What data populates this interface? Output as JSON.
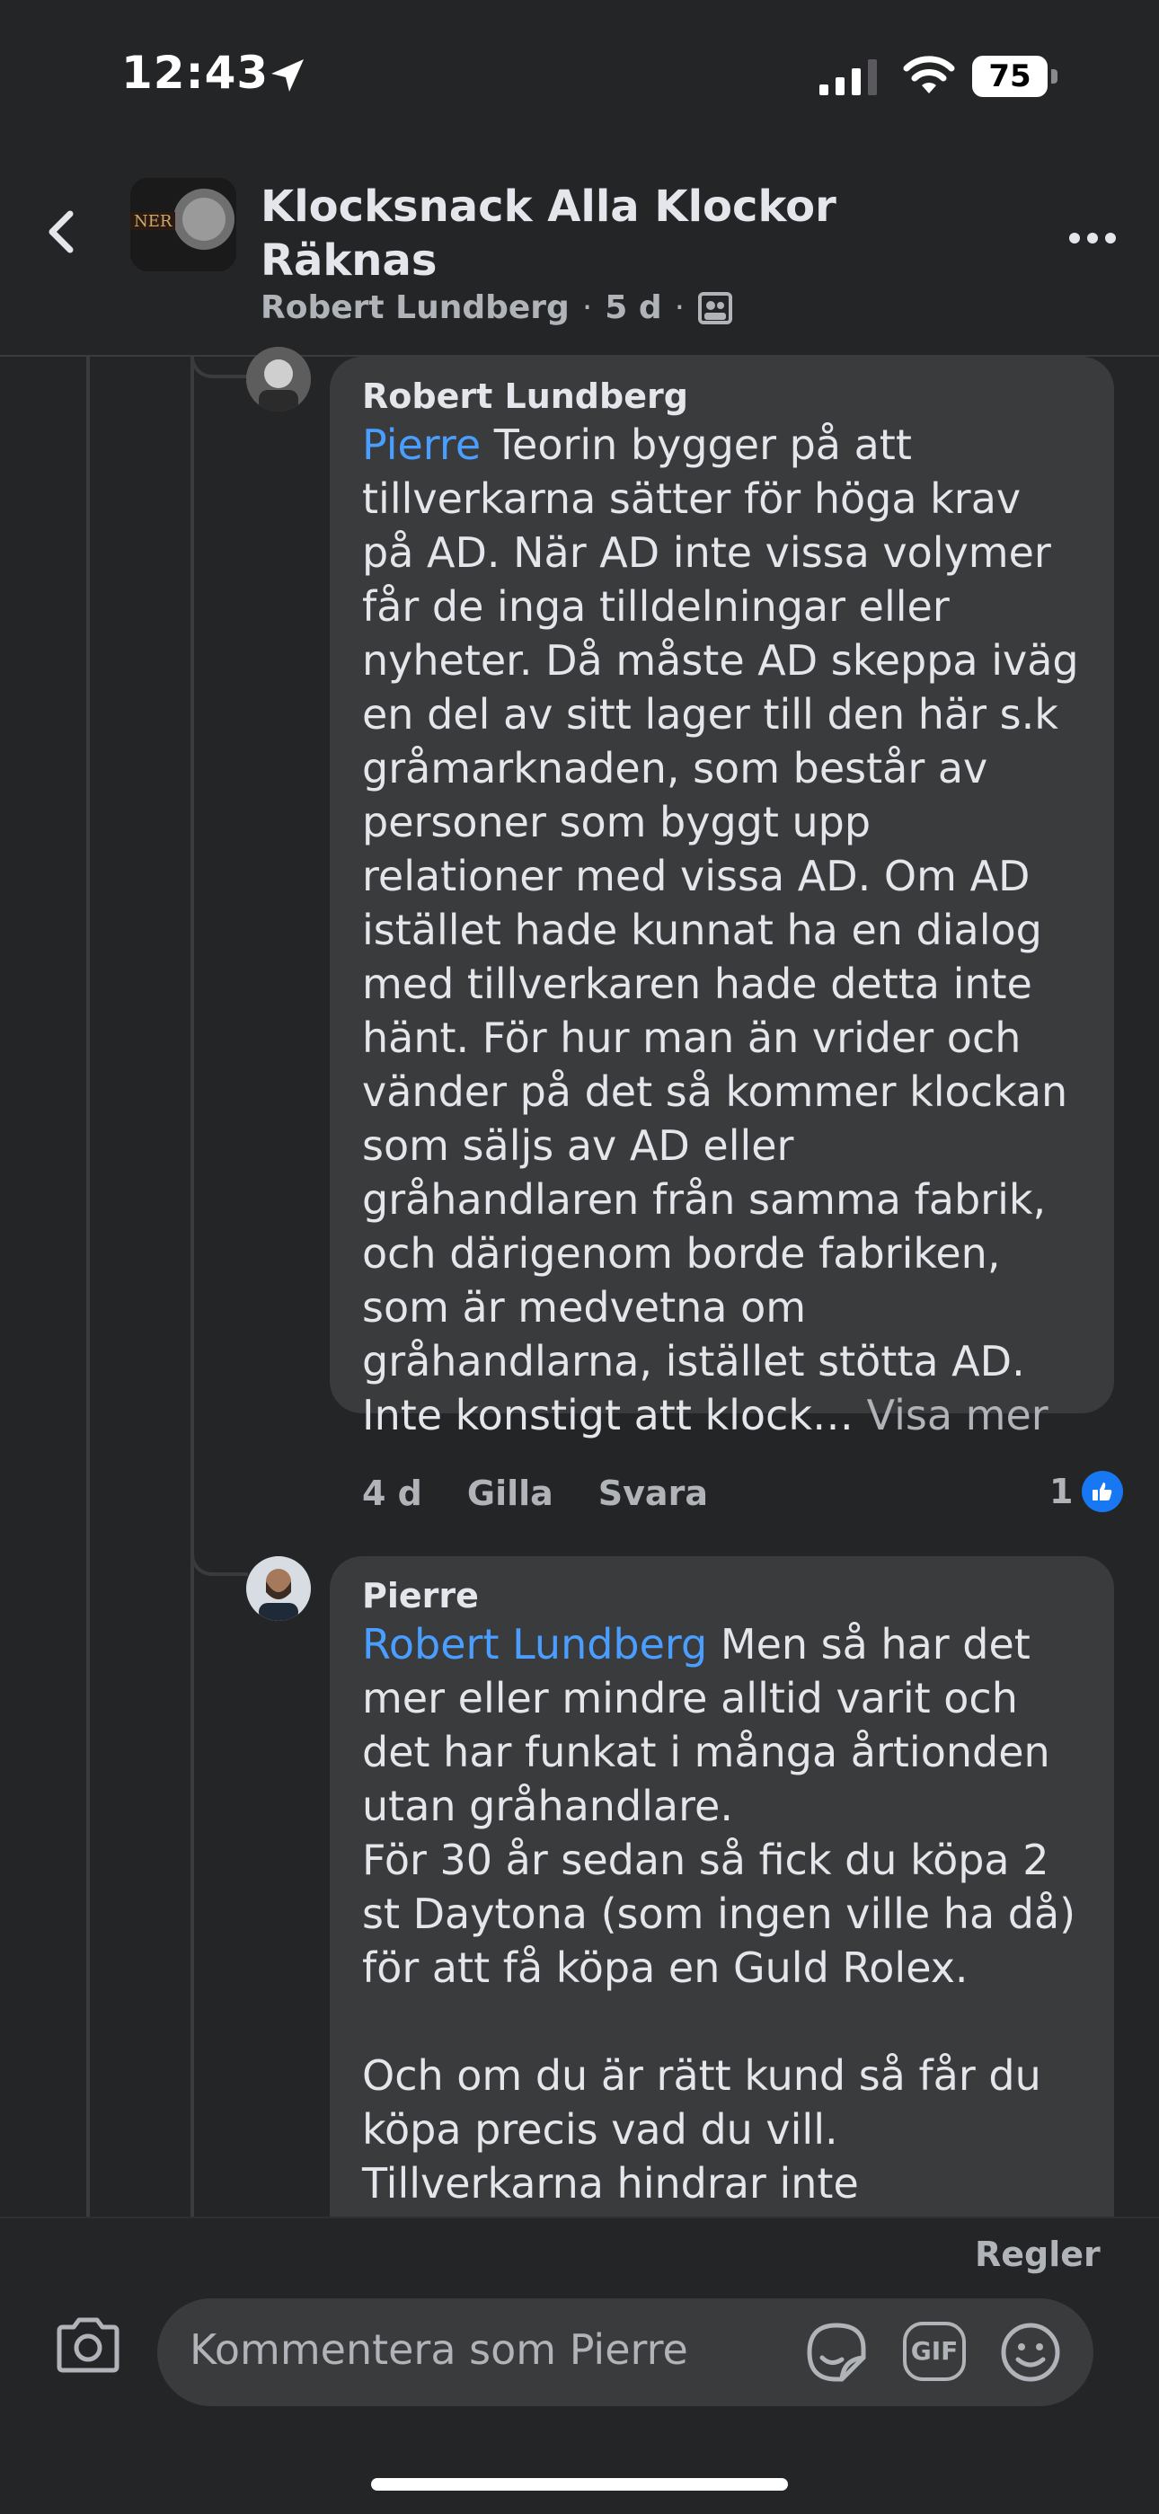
{
  "status_bar": {
    "time": "12:43",
    "battery": "75",
    "location_icon": "location-arrow-icon",
    "signal_icon": "cellular-signal-icon",
    "wifi_icon": "wifi-icon"
  },
  "header": {
    "back_icon": "chevron-left-icon",
    "group_title": "Klocksnack Alla Klockor Räknas",
    "post_author": "Robert Lundberg",
    "post_age": "5 d",
    "separator": "·",
    "audience_icon": "group-members-icon",
    "more_icon": "more-horizontal-icon"
  },
  "comments": [
    {
      "author": "Robert Lundberg",
      "mention": "Pierre",
      "text": "Teorin bygger på att tillverkarna sätter för höga krav på AD. När AD inte vissa volymer får de inga tilldelningar eller nyheter. Då måste AD skeppa iväg en del av sitt lager till den här s.k gråmarknaden, som består av personer som byggt upp relationer med vissa AD. Om AD istället hade kunnat ha en dialog med tillverkaren hade detta inte hänt. För hur man än vrider och vänder på det så kommer klockan som säljs av AD eller gråhandlaren från samma fabrik, och därigenom borde fabriken, som är medvetna om gråhandlarna, istället stötta AD. Inte konstigt att klock…",
      "see_more": "Visa mer",
      "age": "4 d",
      "like_label": "Gilla",
      "reply_label": "Svara",
      "reaction_count": "1"
    },
    {
      "author": "Pierre",
      "mention": "Robert Lundberg",
      "text_p1": "Men så har det mer eller mindre alltid varit och det har funkat i många årtionden utan gråhandlare.",
      "text_p2": "För 30 år sedan så fick du köpa 2 st Daytona (som ingen ville ha då) för att få köpa en Guld Rolex.",
      "text_p3": "Och om du är rätt kund så får du köpa precis vad du vill.",
      "text_p4": "Tillverkarna hindrar inte"
    }
  ],
  "composer": {
    "rules_label": "Regler",
    "placeholder": "Kommentera som Pierre",
    "gif_label": "GIF",
    "camera_icon": "camera-icon",
    "sticker_icon": "sticker-icon",
    "emoji_icon": "smiley-icon"
  }
}
